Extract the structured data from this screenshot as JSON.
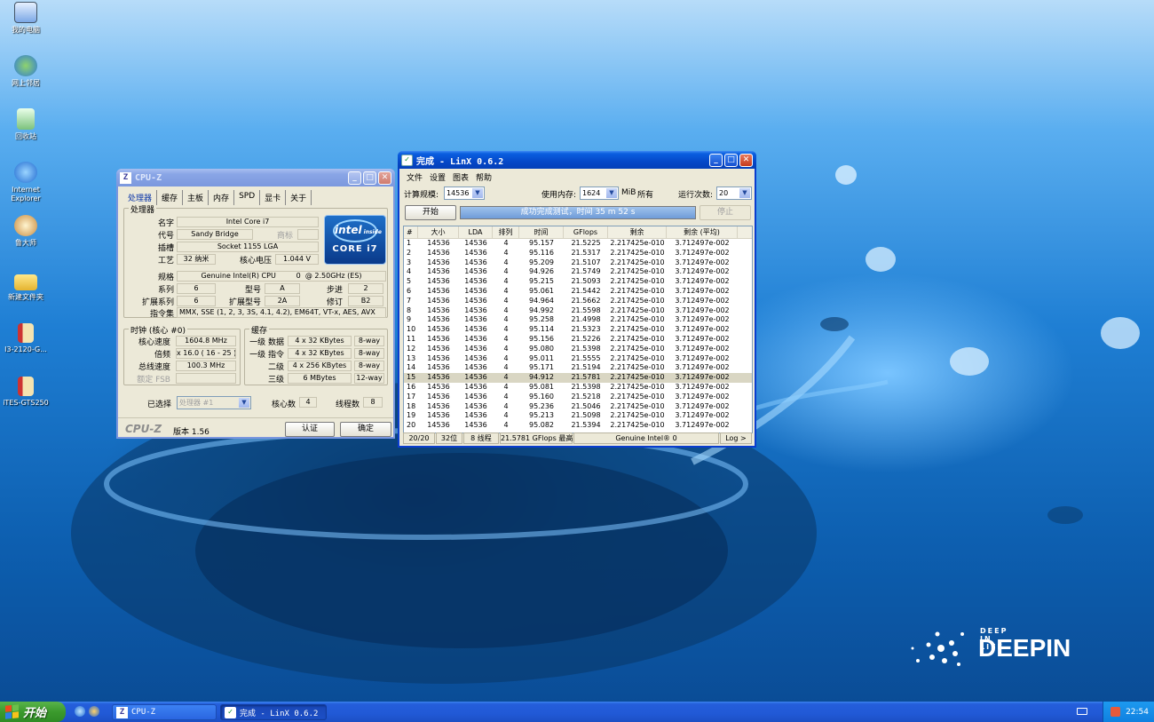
{
  "desktop": {
    "icons": [
      {
        "label": "我的电脑",
        "icon": "computer-icon"
      },
      {
        "label": "网上邻居",
        "icon": "network-icon"
      },
      {
        "label": "回收站",
        "icon": "recycle-bin-icon"
      },
      {
        "label": "Internet Explorer",
        "icon": "ie-icon"
      },
      {
        "label": "鲁大师",
        "icon": "ludashi-icon"
      },
      {
        "label": "新建文件夹",
        "icon": "folder-icon"
      },
      {
        "label": "I3-2120-G...",
        "icon": "archive-icon"
      },
      {
        "label": "iTES-GTS250",
        "icon": "archive-icon"
      }
    ],
    "logo_tagline": "DEEP IN LIFE",
    "logo_name": "DEEPIN"
  },
  "cpuz": {
    "title": "CPU-Z",
    "icon_letter": "Z",
    "tabs": [
      "处理器",
      "缓存",
      "主板",
      "内存",
      "SPD",
      "显卡",
      "关于"
    ],
    "processor_group": "处理器",
    "labels": {
      "name": "名字",
      "codename": "代号",
      "brand": "商标",
      "package": "插槽",
      "tech": "工艺",
      "voltage": "核心电压",
      "spec": "规格",
      "family": "系列",
      "model": "型号",
      "stepping": "步进",
      "ext_family": "扩展系列",
      "ext_model": "扩展型号",
      "revision": "修订",
      "instructions": "指令集"
    },
    "values": {
      "name": "Intel Core i7",
      "codename": "Sandy Bridge",
      "package": "Socket 1155 LGA",
      "tech": "32 纳米",
      "voltage": "1.044 V",
      "spec": "Genuine Intel(R) CPU         0  @ 2.50GHz (ES)",
      "family": "6",
      "model": "A",
      "stepping": "2",
      "ext_family": "6",
      "ext_model": "2A",
      "revision": "B2",
      "instructions": "MMX, SSE (1, 2, 3, 3S, 4.1, 4.2), EM64T, VT-x, AES, AVX"
    },
    "badge": {
      "top": "intel",
      "sub": "inside",
      "bottom": "CORE i7"
    },
    "clocks_group": "时钟 (核心 #0)",
    "clocks": {
      "core_speed_label": "核心速度",
      "core_speed": "1604.8 MHz",
      "multiplier_label": "倍频",
      "multiplier": "x 16.0 ( 16 - 25 )",
      "bus_label": "总线速度",
      "bus": "100.3 MHz",
      "fsb_label": "额定 FSB",
      "fsb": ""
    },
    "cache_group": "缓存",
    "cache": [
      {
        "label": "一级 数据",
        "size": "4 x 32 KBytes",
        "way": "8-way"
      },
      {
        "label": "一级 指令",
        "size": "4 x 32 KBytes",
        "way": "8-way"
      },
      {
        "label": "二级",
        "size": "4 x 256 KBytes",
        "way": "8-way"
      },
      {
        "label": "三级",
        "size": "6 MBytes",
        "way": "12-way"
      }
    ],
    "selection_label": "已选择",
    "selection_value": "处理器 #1",
    "cores_label": "核心数",
    "cores": "4",
    "threads_label": "线程数",
    "threads": "8",
    "brand_footer": "CPU-Z",
    "version": "版本 1.56",
    "validate": "认证",
    "ok": "确定"
  },
  "linx": {
    "title": "完成 - LinX 0.6.2",
    "menu": [
      "文件",
      "设置",
      "图表",
      "帮助"
    ],
    "problem_size_label": "计算规模:",
    "problem_size": "14536",
    "memory_label": "使用内存:",
    "memory_value": "1624",
    "memory_unit": "MiB",
    "memory_all": "所有",
    "runs_label": "运行次数:",
    "runs": "20",
    "start_button": "开始",
    "progress_text": "成功完成测试，时间 35 m 52 s",
    "progress_fraction": 1.0,
    "stop_button": "停止",
    "columns": [
      "#",
      "大小",
      "LDA",
      "排列",
      "时间",
      "GFlops",
      "剩余",
      "剩余 (平均)"
    ],
    "rows": [
      [
        "1",
        "14536",
        "14536",
        "4",
        "95.157",
        "21.5225",
        "2.217425e-010",
        "3.712497e-002"
      ],
      [
        "2",
        "14536",
        "14536",
        "4",
        "95.116",
        "21.5317",
        "2.217425e-010",
        "3.712497e-002"
      ],
      [
        "3",
        "14536",
        "14536",
        "4",
        "95.209",
        "21.5107",
        "2.217425e-010",
        "3.712497e-002"
      ],
      [
        "4",
        "14536",
        "14536",
        "4",
        "94.926",
        "21.5749",
        "2.217425e-010",
        "3.712497e-002"
      ],
      [
        "5",
        "14536",
        "14536",
        "4",
        "95.215",
        "21.5093",
        "2.217425e-010",
        "3.712497e-002"
      ],
      [
        "6",
        "14536",
        "14536",
        "4",
        "95.061",
        "21.5442",
        "2.217425e-010",
        "3.712497e-002"
      ],
      [
        "7",
        "14536",
        "14536",
        "4",
        "94.964",
        "21.5662",
        "2.217425e-010",
        "3.712497e-002"
      ],
      [
        "8",
        "14536",
        "14536",
        "4",
        "94.992",
        "21.5598",
        "2.217425e-010",
        "3.712497e-002"
      ],
      [
        "9",
        "14536",
        "14536",
        "4",
        "95.258",
        "21.4998",
        "2.217425e-010",
        "3.712497e-002"
      ],
      [
        "10",
        "14536",
        "14536",
        "4",
        "95.114",
        "21.5323",
        "2.217425e-010",
        "3.712497e-002"
      ],
      [
        "11",
        "14536",
        "14536",
        "4",
        "95.156",
        "21.5226",
        "2.217425e-010",
        "3.712497e-002"
      ],
      [
        "12",
        "14536",
        "14536",
        "4",
        "95.080",
        "21.5398",
        "2.217425e-010",
        "3.712497e-002"
      ],
      [
        "13",
        "14536",
        "14536",
        "4",
        "95.011",
        "21.5555",
        "2.217425e-010",
        "3.712497e-002"
      ],
      [
        "14",
        "14536",
        "14536",
        "4",
        "95.171",
        "21.5194",
        "2.217425e-010",
        "3.712497e-002"
      ],
      [
        "15",
        "14536",
        "14536",
        "4",
        "94.912",
        "21.5781",
        "2.217425e-010",
        "3.712497e-002"
      ],
      [
        "16",
        "14536",
        "14536",
        "4",
        "95.081",
        "21.5398",
        "2.217425e-010",
        "3.712497e-002"
      ],
      [
        "17",
        "14536",
        "14536",
        "4",
        "95.160",
        "21.5218",
        "2.217425e-010",
        "3.712497e-002"
      ],
      [
        "18",
        "14536",
        "14536",
        "4",
        "95.236",
        "21.5046",
        "2.217425e-010",
        "3.712497e-002"
      ],
      [
        "19",
        "14536",
        "14536",
        "4",
        "95.213",
        "21.5098",
        "2.217425e-010",
        "3.712497e-002"
      ],
      [
        "20",
        "14536",
        "14536",
        "4",
        "95.082",
        "21.5394",
        "2.217425e-010",
        "3.712497e-002"
      ]
    ],
    "selected_row": "15",
    "status": {
      "progress": "20/20",
      "bits": "32位",
      "threads": "8 线程",
      "peak": "21.5781 GFlops 最高",
      "cpu": "Genuine Intel® 0",
      "log": "Log >"
    }
  },
  "taskbar": {
    "start_label": "开始",
    "tasks": [
      {
        "label": "CPU-Z",
        "icon": "cpuz-icon"
      },
      {
        "label": "完成 - LinX 0.6.2",
        "icon": "linx-icon"
      }
    ],
    "clock": "22:54"
  },
  "colors": {
    "xp_blue": "#0548c8",
    "start_green": "#3b9a2d",
    "progress": "#6f9bd8"
  }
}
